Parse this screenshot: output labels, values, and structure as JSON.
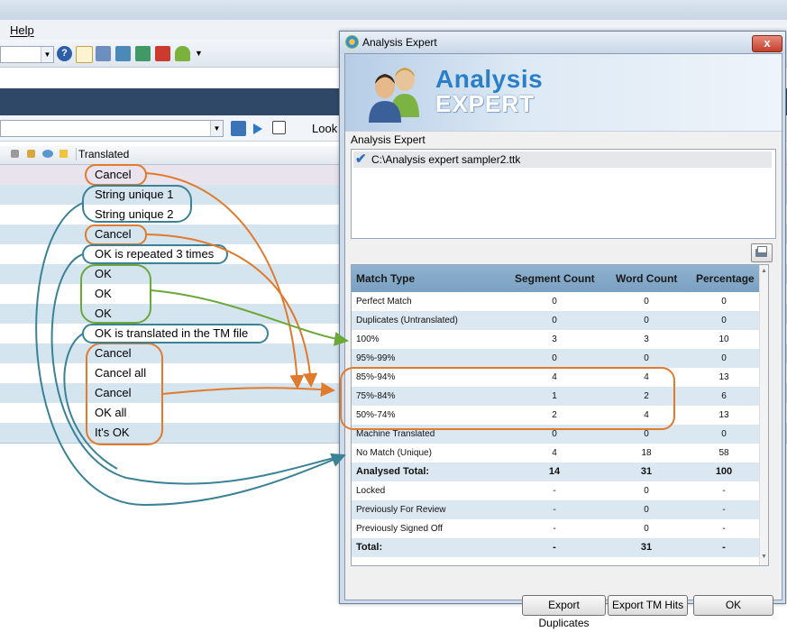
{
  "app": {
    "menu_help": "Help",
    "toolbar2_label": "Look",
    "grid_header_translated": "Translated",
    "rows": [
      {
        "text": "Cancel",
        "bg": "#e9e3ee"
      },
      {
        "text": "String unique 1",
        "bg": "#d5e5f0"
      },
      {
        "text": "String unique 2",
        "bg": "#ffffff"
      },
      {
        "text": "Cancel",
        "bg": "#d5e5f0"
      },
      {
        "text": "OK is repeated 3 times",
        "bg": "#ffffff"
      },
      {
        "text": "OK",
        "bg": "#d5e5f0"
      },
      {
        "text": "OK",
        "bg": "#ffffff"
      },
      {
        "text": "OK",
        "bg": "#d5e5f0"
      },
      {
        "text": "OK is translated in the TM file",
        "bg": "#ffffff"
      },
      {
        "text": "Cancel",
        "bg": "#d5e5f0"
      },
      {
        "text": "Cancel all",
        "bg": "#ffffff"
      },
      {
        "text": "Cancel",
        "bg": "#d5e5f0"
      },
      {
        "text": "OK all",
        "bg": "#ffffff"
      },
      {
        "text": "It's OK",
        "bg": "#d5e5f0"
      }
    ]
  },
  "dialog": {
    "title": "Analysis Expert",
    "close_label": "x",
    "banner_title_1": "Analysis",
    "banner_title_2": "EXPERT",
    "section_label": "Analysis Expert",
    "file_path": "C:\\Analysis expert sampler2.ttk",
    "table": {
      "headers": [
        "Match Type",
        "Segment Count",
        "Word Count",
        "Percentage"
      ],
      "rows": [
        {
          "type": "Perfect Match",
          "seg": "0",
          "word": "0",
          "pct": "0",
          "bold": false
        },
        {
          "type": "Duplicates (Untranslated)",
          "seg": "0",
          "word": "0",
          "pct": "0",
          "bold": false
        },
        {
          "type": "100%",
          "seg": "3",
          "word": "3",
          "pct": "10",
          "bold": false
        },
        {
          "type": "95%-99%",
          "seg": "0",
          "word": "0",
          "pct": "0",
          "bold": false
        },
        {
          "type": "85%-94%",
          "seg": "4",
          "word": "4",
          "pct": "13",
          "bold": false
        },
        {
          "type": "75%-84%",
          "seg": "1",
          "word": "2",
          "pct": "6",
          "bold": false
        },
        {
          "type": "50%-74%",
          "seg": "2",
          "word": "4",
          "pct": "13",
          "bold": false
        },
        {
          "type": "Machine Translated",
          "seg": "0",
          "word": "0",
          "pct": "0",
          "bold": false
        },
        {
          "type": "No Match (Unique)",
          "seg": "4",
          "word": "18",
          "pct": "58",
          "bold": false
        },
        {
          "type": "Analysed Total:",
          "seg": "14",
          "word": "31",
          "pct": "100",
          "bold": true
        },
        {
          "type": "Locked",
          "seg": "-",
          "word": "0",
          "pct": "-",
          "bold": false
        },
        {
          "type": "Previously For Review",
          "seg": "-",
          "word": "0",
          "pct": "-",
          "bold": false
        },
        {
          "type": "Previously Signed Off",
          "seg": "-",
          "word": "0",
          "pct": "-",
          "bold": false
        },
        {
          "type": "Total:",
          "seg": "-",
          "word": "31",
          "pct": "-",
          "bold": true
        }
      ]
    },
    "buttons": {
      "export_duplicates": "Export Duplicates",
      "export_tm_hits": "Export TM Hits",
      "ok": "OK"
    }
  },
  "colors": {
    "annotation_orange": "#e07a2c",
    "annotation_teal": "#3b8296",
    "annotation_green": "#6aa83a"
  }
}
